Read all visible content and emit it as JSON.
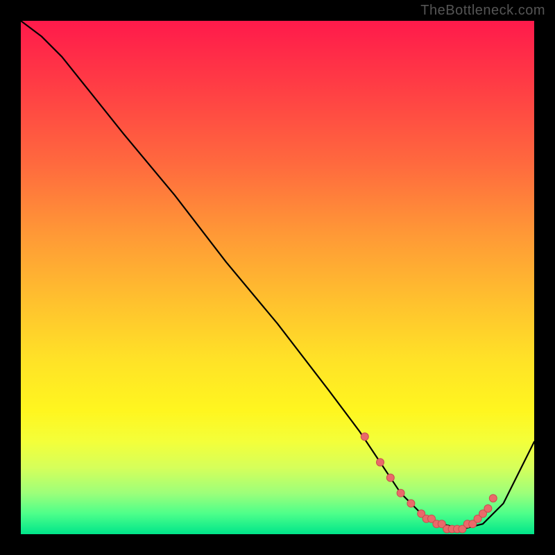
{
  "watermark": "TheBottleneck.com",
  "colors": {
    "curve_stroke": "#000000",
    "marker_fill": "#e96a6a",
    "marker_stroke": "#c94f4f"
  },
  "chart_data": {
    "type": "line",
    "title": "",
    "xlabel": "",
    "ylabel": "",
    "xlim": [
      0,
      100
    ],
    "ylim": [
      0,
      100
    ],
    "series": [
      {
        "name": "bottleneck-curve",
        "x": [
          0,
          4,
          8,
          12,
          20,
          30,
          40,
          50,
          60,
          66,
          70,
          74,
          78,
          82,
          86,
          90,
          94,
          98,
          100
        ],
        "y": [
          100,
          97,
          93,
          88,
          78,
          66,
          53,
          41,
          28,
          20,
          14,
          8,
          4,
          2,
          1,
          2,
          6,
          14,
          18
        ]
      }
    ],
    "markers": {
      "name": "highlighted-points",
      "x": [
        67,
        70,
        72,
        74,
        76,
        78,
        79,
        80,
        81,
        82,
        83,
        84,
        85,
        86,
        87,
        88,
        89,
        90,
        91,
        92
      ],
      "y": [
        19,
        14,
        11,
        8,
        6,
        4,
        3,
        3,
        2,
        2,
        1,
        1,
        1,
        1,
        2,
        2,
        3,
        4,
        5,
        7
      ]
    }
  }
}
